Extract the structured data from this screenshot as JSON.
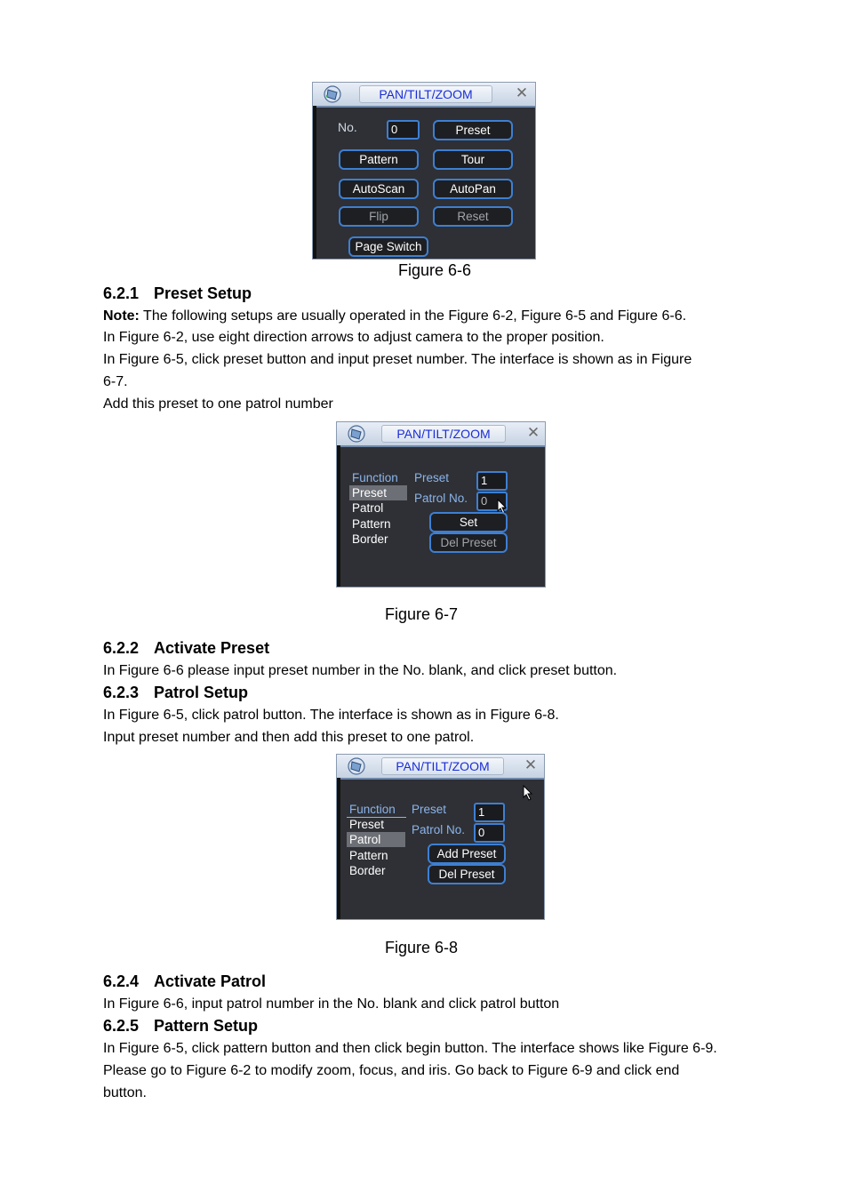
{
  "figure66": {
    "title": "PAN/TILT/ZOOM",
    "no_label": "No.",
    "no_value": "0",
    "buttons": {
      "preset": "Preset",
      "pattern": "Pattern",
      "tour": "Tour",
      "autoscan": "AutoScan",
      "autopan": "AutoPan",
      "flip": "Flip",
      "reset": "Reset",
      "page_switch": "Page Switch"
    },
    "caption": "Figure 6-6"
  },
  "section621": {
    "number": "6.2.1",
    "title": "Preset Setup",
    "note_label": "Note:",
    "note_text": " The following setups are usually operated in the Figure 6-2, Figure 6-5 and Figure 6-6.",
    "line1": "In Figure 6-2, use eight direction arrows to adjust camera to the proper position.",
    "line2": "In Figure 6-5, click preset button and input preset number. The interface is shown as in Figure",
    "line3": "6-7.",
    "line4": "Add this preset to one patrol number"
  },
  "figure67": {
    "title": "PAN/TILT/ZOOM",
    "menu_head": "Function",
    "menu": [
      "Preset",
      "Patrol",
      "Pattern",
      "Border"
    ],
    "selected": "Preset",
    "preset_label": "Preset",
    "preset_value": "1",
    "patrol_label": "Patrol No.",
    "patrol_value": "0",
    "set_button": "Set",
    "del_button": "Del Preset",
    "caption": "Figure 6-7"
  },
  "section622": {
    "number": "6.2.2",
    "title": "Activate Preset",
    "text": "In Figure 6-6 please input preset number in the No. blank, and click preset button."
  },
  "section623": {
    "number": "6.2.3",
    "title": "Patrol Setup",
    "line1": "In Figure 6-5, click patrol button. The interface is shown as in Figure 6-8.",
    "line2": "Input preset number and then add this preset to one patrol."
  },
  "figure68": {
    "title": "PAN/TILT/ZOOM",
    "menu_head": "Function",
    "menu": [
      "Preset",
      "Patrol",
      "Pattern",
      "Border"
    ],
    "selected": "Patrol",
    "preset_label": "Preset",
    "preset_value": "1",
    "patrol_label": "Patrol No.",
    "patrol_value": "0",
    "add_button": "Add Preset",
    "del_button": "Del Preset",
    "caption": "Figure 6-8"
  },
  "section624": {
    "number": "6.2.4",
    "title": "Activate Patrol",
    "text": "In Figure 6-6, input patrol number in the No. blank and click patrol button"
  },
  "section625": {
    "number": "6.2.5",
    "title": "Pattern Setup",
    "line1": "In Figure 6-5, click pattern button and then click begin button. The interface shows like Figure 6-9.",
    "line2": "Please go to Figure 6-2 to modify zoom, focus, and iris.  Go back to Figure 6-9 and click end",
    "line3": "button."
  }
}
